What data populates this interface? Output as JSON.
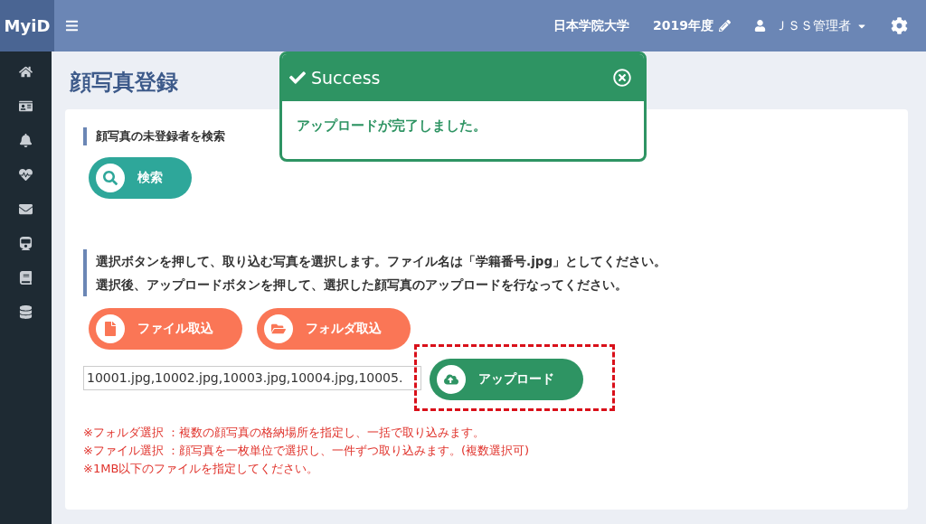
{
  "brand": "MyiD",
  "header": {
    "university": "日本学院大学",
    "year": "2019年度",
    "user": "ＪＳＳ管理者"
  },
  "sidebar": {
    "items": [
      {
        "kind": "home"
      },
      {
        "kind": "card"
      },
      {
        "kind": "bell"
      },
      {
        "kind": "heart"
      },
      {
        "kind": "mail"
      },
      {
        "kind": "train"
      },
      {
        "kind": "book"
      },
      {
        "kind": "database"
      }
    ]
  },
  "page_title": "顔写真登録",
  "toast": {
    "title": "Success",
    "message": "アップロードが完了しました。"
  },
  "search_section": {
    "heading": "顔写真の未登録者を検索",
    "button": {
      "kind": "search",
      "label": "検索"
    }
  },
  "upload_section": {
    "instructions": [
      "選択ボタンを押して、取り込む写真を選択します。ファイル名は「学籍番号.jpg」としてください。",
      "選択後、アップロードボタンを押して、選択した顔写真のアップロードを行なってください。"
    ],
    "buttons": [
      {
        "kind": "file",
        "label": "ファイル取込"
      },
      {
        "kind": "folder",
        "label": "フォルダ取込"
      }
    ],
    "file_field": {
      "value": "10001.jpg,10002.jpg,10003.jpg,10004.jpg,10005."
    },
    "upload_button": {
      "kind": "upload",
      "label": "アップロード"
    },
    "notes": [
      "※フォルダ選択 ：複数の顔写真の格納場所を指定し、一括で取り込みます。",
      "※ファイル選択 ：顔写真を一枚単位で選択し、一件ずつ取り込みます。(複数選択可)",
      "※1MB以下のファイルを指定してください。"
    ]
  }
}
